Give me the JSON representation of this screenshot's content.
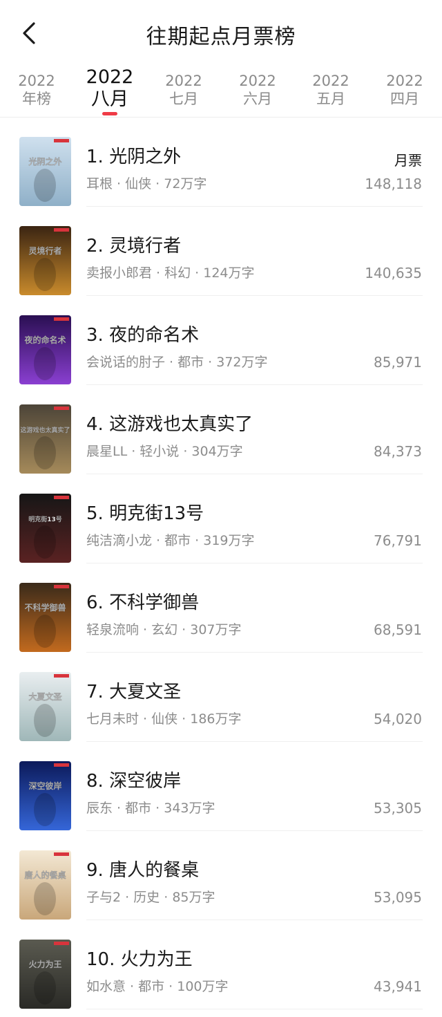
{
  "header": {
    "title": "往期起点月票榜"
  },
  "tabs": [
    {
      "year": "2022",
      "label": "年榜",
      "active": false
    },
    {
      "year": "2022",
      "label": "八月",
      "active": true
    },
    {
      "year": "2022",
      "label": "七月",
      "active": false
    },
    {
      "year": "2022",
      "label": "六月",
      "active": false
    },
    {
      "year": "2022",
      "label": "五月",
      "active": false
    },
    {
      "year": "2022",
      "label": "四月",
      "active": false
    }
  ],
  "list_header": {
    "votes_label": "月票"
  },
  "books": [
    {
      "rank_title": "1. 光阴之外",
      "meta": "耳根 · 仙侠 · 72万字",
      "votes": "148,118",
      "cover_text": "光阴之外",
      "cover_colors": [
        "#cfe0ee",
        "#8fb0c8"
      ]
    },
    {
      "rank_title": "2. 灵境行者",
      "meta": "卖报小郎君 · 科幻 · 124万字",
      "votes": "140,635",
      "cover_text": "灵境行者",
      "cover_colors": [
        "#3a2412",
        "#c98b2c"
      ]
    },
    {
      "rank_title": "3. 夜的命名术",
      "meta": "会说话的肘子 · 都市 · 372万字",
      "votes": "85,971",
      "cover_text": "夜的命名术",
      "cover_colors": [
        "#2a0f52",
        "#8a3fd1"
      ]
    },
    {
      "rank_title": "4. 这游戏也太真实了",
      "meta": "晨星LL · 轻小说 · 304万字",
      "votes": "84,373",
      "cover_text": "这游戏也太真实了",
      "cover_colors": [
        "#4c4438",
        "#a58a5a"
      ]
    },
    {
      "rank_title": "5. 明克街13号",
      "meta": "纯洁滴小龙 · 都市 · 319万字",
      "votes": "76,791",
      "cover_text": "明克街13号",
      "cover_colors": [
        "#161616",
        "#5a2222"
      ]
    },
    {
      "rank_title": "6. 不科学御兽",
      "meta": "轻泉流响 · 玄幻 · 307万字",
      "votes": "68,591",
      "cover_text": "不科学御兽",
      "cover_colors": [
        "#3a2a1a",
        "#c26a1e"
      ]
    },
    {
      "rank_title": "7. 大夏文圣",
      "meta": "七月未时 · 仙侠 · 186万字",
      "votes": "54,020",
      "cover_text": "大夏文圣",
      "cover_colors": [
        "#e9eef0",
        "#9fb7b8"
      ]
    },
    {
      "rank_title": "8. 深空彼岸",
      "meta": "辰东 · 都市 · 343万字",
      "votes": "53,305",
      "cover_text": "深空彼岸",
      "cover_colors": [
        "#0c1a5a",
        "#3566d8"
      ]
    },
    {
      "rank_title": "9. 唐人的餐桌",
      "meta": "子与2 · 历史 · 85万字",
      "votes": "53,095",
      "cover_text": "唐人的餐桌",
      "cover_colors": [
        "#f3e8d4",
        "#c9a77a"
      ]
    },
    {
      "rank_title": "10. 火力为王",
      "meta": "如水意 · 都市 · 100万字",
      "votes": "43,941",
      "cover_text": "火力为王",
      "cover_colors": [
        "#5a5a50",
        "#2a2a26"
      ]
    }
  ]
}
